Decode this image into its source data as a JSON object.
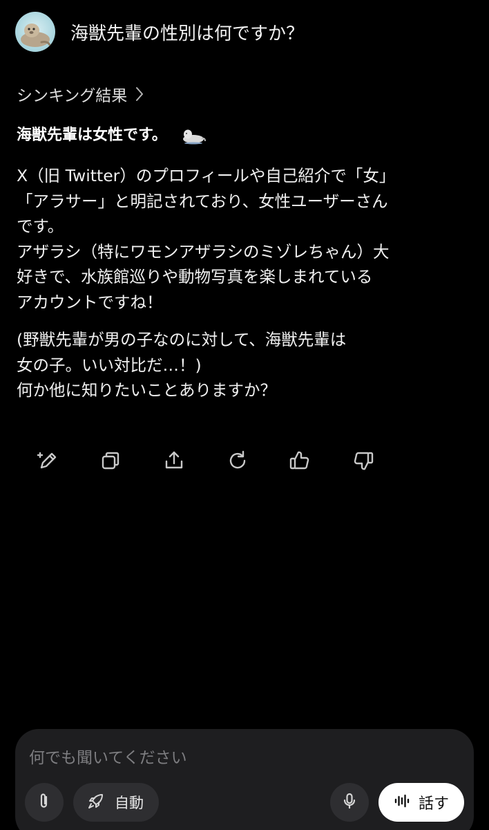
{
  "user_message": {
    "text": "海獣先輩の性別は何ですか？",
    "avatar_icon": "seal-avatar-icon"
  },
  "thinking": {
    "label": "シンキング結果",
    "icon": "chevron-right-icon"
  },
  "answer": {
    "headline": "海獣先輩は女性です。",
    "headline_emoji": "seal-emoji-icon",
    "paragraph1": [
      "X（旧 Twitter）のプロフィールや自己紹介で「女」",
      "「アラサー」と明記されており、女性ユーザーさん",
      "です。",
      "アザラシ（特にワモンアザラシのミゾレちゃん）大",
      "好きで、水族館巡りや動物写真を楽しまれている",
      "アカウントですね！"
    ],
    "paragraph2": [
      "(野獣先輩が男の子なのに対して、海獣先輩は",
      "女の子。いい対比だ…！)",
      "何か他に知りたいことありますか？"
    ]
  },
  "actions": [
    {
      "name": "edit-button",
      "icon": "edit-icon"
    },
    {
      "name": "copy-button",
      "icon": "copy-icon"
    },
    {
      "name": "share-button",
      "icon": "share-icon"
    },
    {
      "name": "regenerate-button",
      "icon": "refresh-icon"
    },
    {
      "name": "like-button",
      "icon": "thumbs-up-icon"
    },
    {
      "name": "dislike-button",
      "icon": "thumbs-down-icon"
    }
  ],
  "composer": {
    "placeholder": "何でも聞いてください",
    "mode_label": "自動",
    "talk_label": "話す",
    "attach_icon": "paperclip-icon",
    "mode_icon": "rocket-icon",
    "mic_icon": "microphone-icon",
    "talk_icon": "voice-wave-icon"
  },
  "colors": {
    "background": "#000000",
    "composer_bg": "#1e1e20",
    "pill_bg": "#2e2e31",
    "text_primary": "#ffffff",
    "text_muted": "#7d7d80",
    "icon": "#c8c8c8"
  }
}
